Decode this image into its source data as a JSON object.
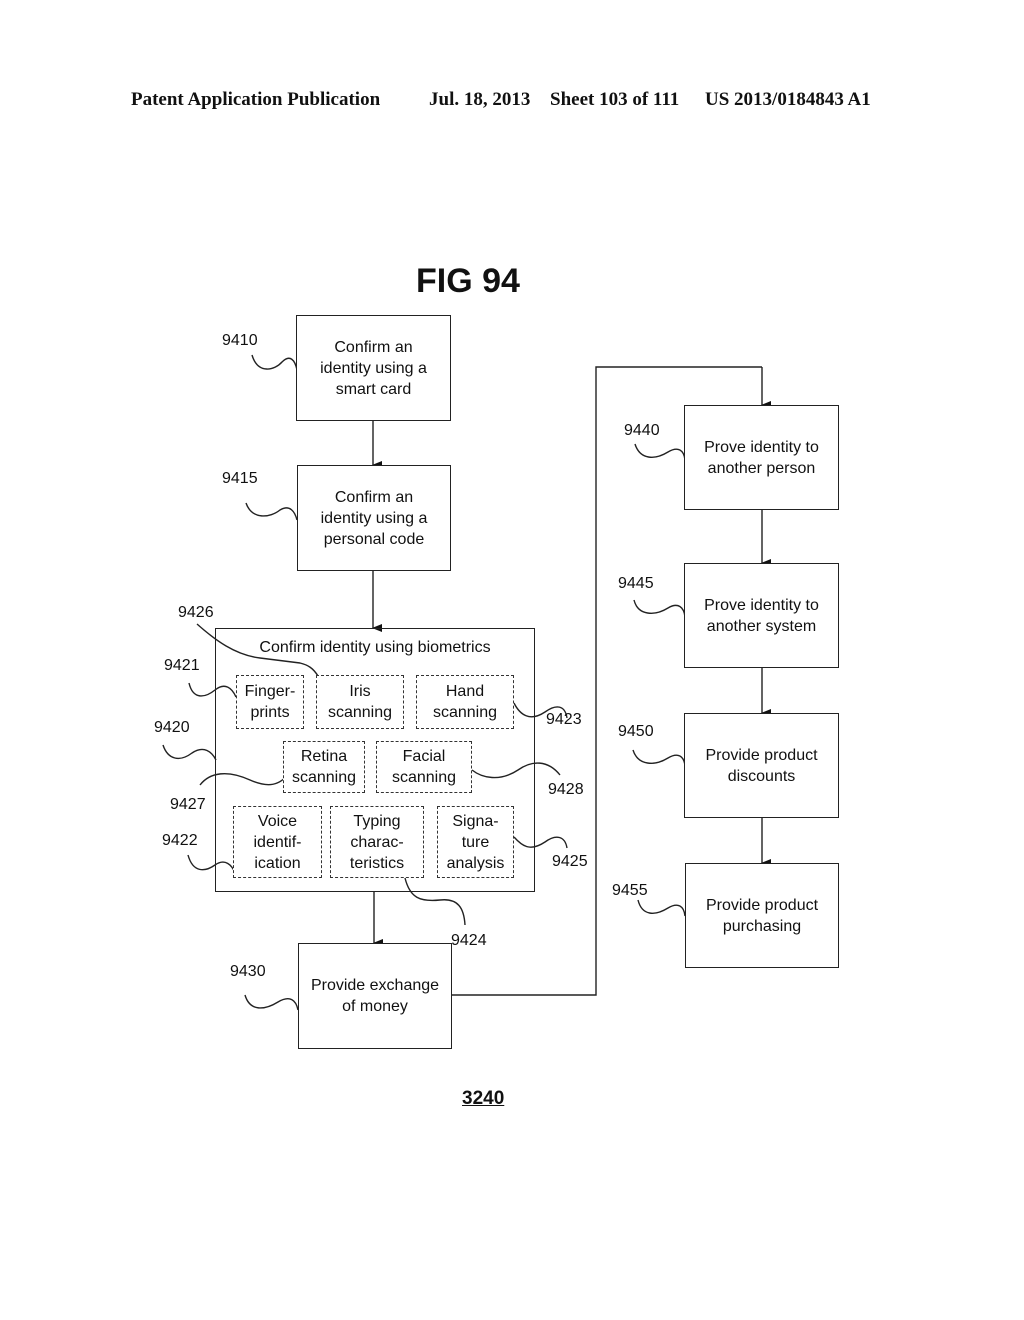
{
  "header": {
    "publication": "Patent Application Publication",
    "date": "Jul. 18, 2013",
    "sheet": "Sheet 103 of 111",
    "patent_number": "US 2013/0184843 A1"
  },
  "figure": {
    "title": "FIG 94",
    "sheet_label": "3240"
  },
  "left_column": [
    {
      "ref": "9410",
      "label": "Confirm an\nidentity using a\nsmart card"
    },
    {
      "ref": "9415",
      "label": "Confirm an\nidentity using a\npersonal code"
    }
  ],
  "biometrics": {
    "ref": "9420",
    "title_ref": "9426",
    "title": "Confirm identity using biometrics",
    "methods": [
      {
        "ref": "9421",
        "label": "Finger-\nprints"
      },
      {
        "ref": "9426",
        "label": "Iris\nscanning"
      },
      {
        "ref": "9423",
        "label": "Hand\nscanning"
      },
      {
        "ref": "9427",
        "label": "Retina\nscanning"
      },
      {
        "ref": "9428",
        "label": "Facial\nscanning"
      },
      {
        "ref": "9422",
        "label": "Voice\nidentif-\nication"
      },
      {
        "ref": "9424",
        "label": "Typing\ncharac-\nteristics"
      },
      {
        "ref": "9425",
        "label": "Signa-\nture\nanalysis"
      }
    ]
  },
  "exchange": {
    "ref": "9430",
    "label": "Provide exchange\nof money"
  },
  "right_column": [
    {
      "ref": "9440",
      "label": "Prove identity to\nanother person"
    },
    {
      "ref": "9445",
      "label": "Prove identity to\nanother system"
    },
    {
      "ref": "9450",
      "label": "Provide product\ndiscounts"
    },
    {
      "ref": "9455",
      "label": "Provide product\npurchasing"
    }
  ]
}
